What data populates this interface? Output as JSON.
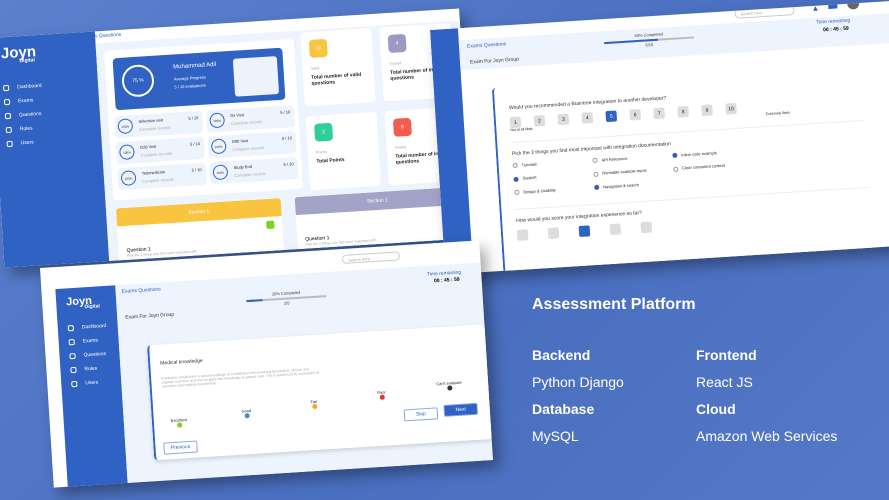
{
  "brand": {
    "logo": "Joyn",
    "sub": "Digital"
  },
  "sidebar": {
    "items": [
      {
        "label": "Dashboard",
        "icon": "clock-icon"
      },
      {
        "label": "Exams",
        "icon": "clipboard-icon"
      },
      {
        "label": "Questions",
        "icon": "question-icon"
      },
      {
        "label": "Roles",
        "icon": "user-icon"
      },
      {
        "label": "Users",
        "icon": "users-icon"
      }
    ]
  },
  "header": {
    "search_placeholder": "Search here",
    "crumb": "Exams Questions"
  },
  "dashboard": {
    "profile": {
      "name": "Muhammad Adil",
      "progress": "75 %",
      "progress_value": 75,
      "sub1": "Average Progress",
      "sub2": "5 / 10 evaluations"
    },
    "records": [
      {
        "title": "Selection visit",
        "pct": "100%",
        "count": "5 / 10",
        "sub": "Complete records"
      },
      {
        "title": "Dx Visit",
        "pct": "100%",
        "count": "5 / 10",
        "sub": "Complete records"
      },
      {
        "title": "D28 Visit",
        "pct": "100%",
        "count": "5 / 10",
        "sub": "Complete records"
      },
      {
        "title": "D90 Visit",
        "pct": "100%",
        "count": "5 / 10",
        "sub": "Complete records"
      },
      {
        "title": "Telemedicine",
        "pct": "100%",
        "count": "5 / 10",
        "sub": "Complete records"
      },
      {
        "title": "Study End",
        "pct": "100%",
        "count": "5 / 10",
        "sub": "Complete records"
      }
    ],
    "stats": [
      {
        "num": "12",
        "tag": "Valid",
        "label": "Total number of valid questions",
        "color": "#f9c440"
      },
      {
        "num": "4",
        "tag": "Invalid",
        "label": "Total number of invalid questions",
        "color": "#9b9ac4"
      },
      {
        "num": "2",
        "tag": "Points",
        "label": "Total Points",
        "color": "#2fcf9c"
      },
      {
        "num": "9",
        "tag": "Invalid",
        "label": "Total number of invalid questions",
        "color": "#f25c4c"
      }
    ],
    "sections": [
      {
        "title": "Section 1",
        "color": "#f9c440",
        "q": "Question 1",
        "qsub": "Pick the 3 things you find most important with"
      },
      {
        "title": "Section 1",
        "color": "#a3a3c8",
        "q": "Question 1",
        "qsub": "Pick the 3 things you find most important with"
      }
    ]
  },
  "exam1": {
    "title": "Exam For Joyn Group",
    "progress_label": "60% Completed",
    "progress_value": 60,
    "count": "6/10",
    "time_label": "Time remaining",
    "time": "00 : 45 : 59",
    "q1": "Would you recommended a Braintree integration to another developer?",
    "scale": [
      "1",
      "2",
      "3",
      "4",
      "5",
      "6",
      "7",
      "8",
      "9",
      "10"
    ],
    "selected": "5",
    "low": "Not at all likely",
    "high": "Extremely likely",
    "q2": "Pick the 3 things you find most important with integration documentation",
    "options": [
      {
        "label": "Tutorials",
        "on": false
      },
      {
        "label": "API Reference",
        "on": false
      },
      {
        "label": "Inline code example",
        "on": true
      },
      {
        "label": "Support",
        "on": true
      },
      {
        "label": "Runnable example repos",
        "on": false
      },
      {
        "label": "Clear consistent content",
        "on": false
      },
      {
        "label": "Design & Usability",
        "on": false
      },
      {
        "label": "Navigation & search",
        "on": true
      }
    ],
    "q3": "How would you score your integration experience so far?"
  },
  "exam2": {
    "title": "Exam For Joyn Group",
    "progress_label": "20% Completed",
    "progress_value": 20,
    "count": "2/5",
    "time_label": "Time remaining",
    "time": "00 : 45 : 59",
    "topic": "Medical knowledge",
    "desc": "Practioner should have a good knowledge of established and envolving biomedical, clinical, and cognate sciences, and how to apply this knowledge to patient care. This is evidenced by completion of education and training requirement.",
    "ratings": [
      {
        "label": "Excellent",
        "color": "#7ed321"
      },
      {
        "label": "Good",
        "color": "#3a8fc4"
      },
      {
        "label": "Fair",
        "color": "#f5a623"
      },
      {
        "label": "Poor",
        "color": "#e8312f"
      },
      {
        "label": "Can't evaluate",
        "color": "#333333"
      }
    ],
    "skip": "Skip",
    "next": "Next",
    "previous": "Previous"
  },
  "promo": {
    "title": "Assessment Platform",
    "backend_label": "Backend",
    "backend": "Python Django",
    "frontend_label": "Frontend",
    "frontend": "React JS",
    "database_label": "Database",
    "database": "MySQL",
    "cloud_label": "Cloud",
    "cloud": "Amazon Web Services"
  }
}
